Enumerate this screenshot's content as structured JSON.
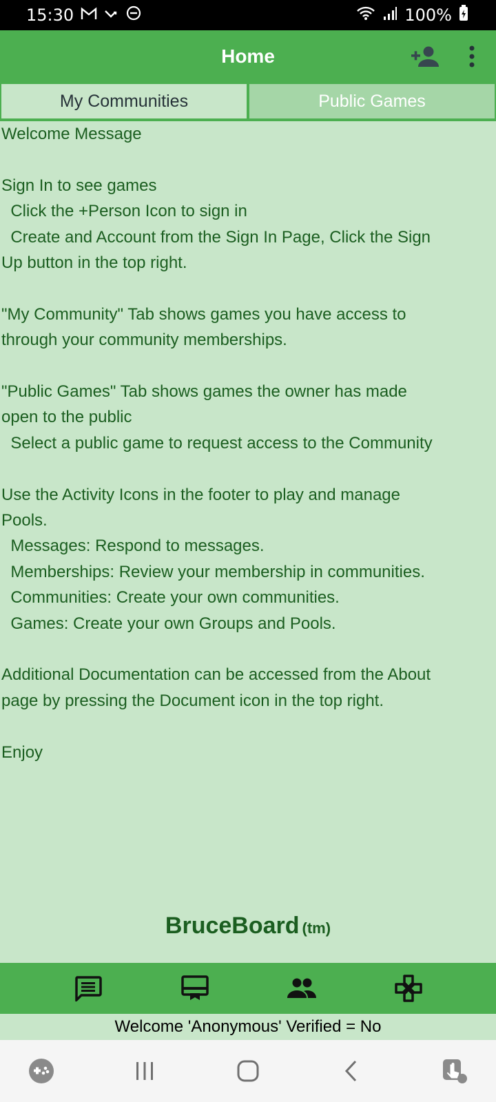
{
  "status_bar": {
    "time": "15:30",
    "battery": "100%"
  },
  "app_bar": {
    "title": "Home"
  },
  "tabs": [
    {
      "label": "My Communities"
    },
    {
      "label": "Public Games"
    }
  ],
  "content": {
    "lines": [
      "Welcome Message",
      "",
      "Sign In to see games",
      "  Click the +Person Icon to sign in",
      "  Create and Account from the Sign In Page, Click the Sign",
      "Up button in the top right.",
      "",
      "\"My Community\" Tab shows games you have access to",
      "through your community memberships.",
      "",
      "\"Public Games\" Tab shows games the owner has made",
      "open to the public",
      "  Select a public game to request access to the Community",
      "",
      "Use the Activity Icons in the footer to play and manage",
      "Pools.",
      "  Messages: Respond to messages.",
      "  Memberships: Review your membership in communities.",
      "  Communities: Create your own communities.",
      "  Games: Create your own Groups and Pools.",
      "",
      "Additional Documentation can be accessed from the About",
      "page by pressing the Document icon in the top right.",
      "",
      "Enjoy"
    ]
  },
  "brand": {
    "name": "BruceBoard",
    "tm": "(tm)"
  },
  "footer": {
    "welcome": "Welcome 'Anonymous' Verified = No"
  },
  "colors": {
    "primary": "#4caf50",
    "background": "#c8e6c9",
    "text": "#1b5e20"
  }
}
